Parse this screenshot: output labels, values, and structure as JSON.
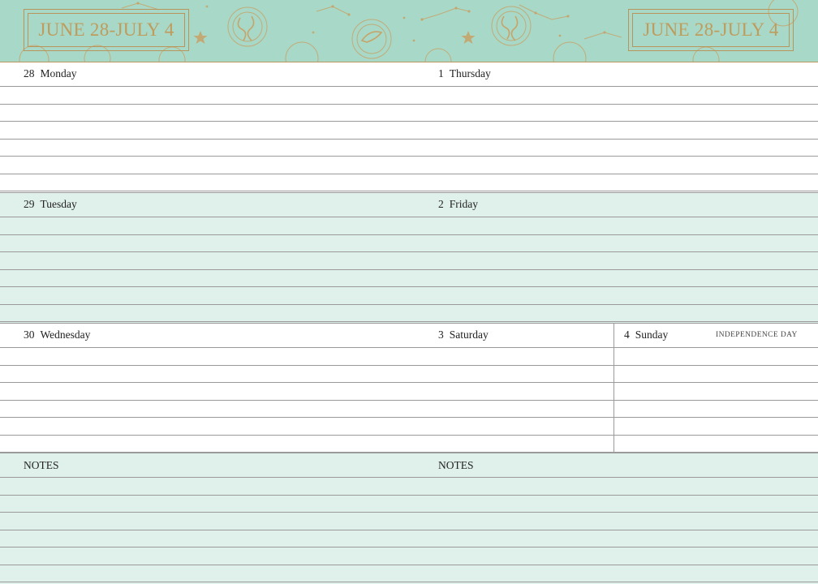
{
  "header": {
    "title_left": "JUNE 28-JULY 4",
    "title_right": "JUNE 28-JULY 4"
  },
  "days": {
    "monday": {
      "num": "28",
      "name": "Monday"
    },
    "tuesday": {
      "num": "29",
      "name": "Tuesday"
    },
    "wednesday": {
      "num": "30",
      "name": "Wednesday"
    },
    "thursday": {
      "num": "1",
      "name": "Thursday"
    },
    "friday": {
      "num": "2",
      "name": "Friday"
    },
    "saturday": {
      "num": "3",
      "name": "Saturday"
    },
    "sunday": {
      "num": "4",
      "name": "Sunday",
      "holiday": "INDEPENDENCE DAY"
    }
  },
  "notes": {
    "left_label": "NOTES",
    "right_label": "NOTES"
  },
  "colors": {
    "banner": "#a8d8c8",
    "gold": "#bf9c5c",
    "mint_band": "#e0f1eb",
    "rule": "#9a9a9a"
  }
}
